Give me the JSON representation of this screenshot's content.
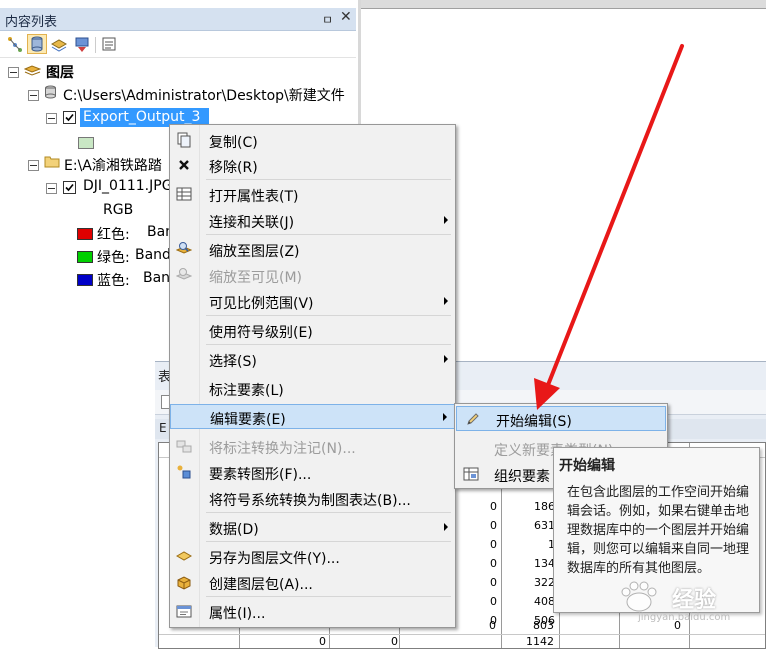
{
  "toc": {
    "title": "内容列表",
    "pin_glyph": "ㅁ",
    "close_glyph": "✕",
    "toolbar_icons": [
      "list-by-drawing-order-icon",
      "list-by-source-icon",
      "list-by-visibility-icon",
      "list-by-selection-icon",
      "options-icon"
    ],
    "tree": {
      "root_label": "图层",
      "source1": "C:\\Users\\Administrator\\Desktop\\新建文件",
      "layer1": "Export_Output_3",
      "source2": "E:\\A渝湘铁路踏",
      "layer2": "DJI_0111.JPG",
      "rgb_label": "RGB",
      "bands": [
        {
          "label": "红色:",
          "value": "Ban",
          "color": "#e00000"
        },
        {
          "label": "绿色:",
          "value": "Band",
          "color": "#00d000"
        },
        {
          "label": "蓝色:",
          "value": "Ban",
          "color": "#0000c8"
        }
      ]
    }
  },
  "table_window": {
    "title_fragment": "表",
    "tab_fragment": "E",
    "rows": [
      [
        "0",
        "186"
      ],
      [
        "0",
        "631"
      ],
      [
        "0",
        "1"
      ],
      [
        "0",
        "134"
      ],
      [
        "0",
        "322"
      ],
      [
        "0",
        "408"
      ],
      [
        "0",
        "506"
      ],
      [
        "0",
        "803",
        "0"
      ],
      [
        "0",
        "0",
        "1142"
      ]
    ]
  },
  "context_menu": {
    "items": [
      {
        "label": "复制(C)",
        "icon": "copy-icon",
        "enabled": true
      },
      {
        "label": "移除(R)",
        "icon": "remove-x-icon",
        "enabled": true
      },
      {
        "label": "打开属性表(T)",
        "icon": "attribute-table-icon",
        "enabled": true
      },
      {
        "label": "连接和关联(J)",
        "icon": "",
        "enabled": true,
        "submenu": true
      },
      {
        "label": "缩放至图层(Z)",
        "icon": "zoom-to-layer-icon",
        "enabled": true
      },
      {
        "label": "缩放至可见(M)",
        "icon": "zoom-to-visible-icon",
        "enabled": false
      },
      {
        "label": "可见比例范围(V)",
        "icon": "",
        "enabled": true,
        "submenu": true
      },
      {
        "label": "使用符号级别(E)",
        "icon": "",
        "enabled": true
      },
      {
        "label": "选择(S)",
        "icon": "",
        "enabled": true,
        "submenu": true
      },
      {
        "label": "标注要素(L)",
        "icon": "",
        "enabled": true
      },
      {
        "label": "编辑要素(E)",
        "icon": "",
        "enabled": true,
        "submenu": true,
        "highlighted": true
      },
      {
        "label": "将标注转换为注记(N)...",
        "icon": "convert-labels-icon",
        "enabled": false
      },
      {
        "label": "要素转图形(F)...",
        "icon": "features-to-graphics-icon",
        "enabled": true
      },
      {
        "label": "将符号系统转换为制图表达(B)...",
        "icon": "",
        "enabled": true
      },
      {
        "label": "数据(D)",
        "icon": "",
        "enabled": true,
        "submenu": true
      },
      {
        "label": "另存为图层文件(Y)...",
        "icon": "save-layer-file-icon",
        "enabled": true
      },
      {
        "label": "创建图层包(A)...",
        "icon": "create-layer-package-icon",
        "enabled": true
      },
      {
        "label": "属性(I)...",
        "icon": "properties-icon",
        "enabled": true
      }
    ]
  },
  "submenu": {
    "items": [
      {
        "label": "开始编辑(S)",
        "icon": "start-editing-pencil-icon",
        "enabled": true,
        "highlighted": true
      },
      {
        "label": "定义新要素类型(N)...",
        "icon": "",
        "enabled": false
      },
      {
        "label": "组织要素",
        "icon": "organize-features-icon",
        "enabled": true
      }
    ]
  },
  "tooltip": {
    "title": "开始编辑",
    "body": "在包含此图层的工作空间开始编辑会话。例如，如果右键单击地理数据库中的一个图层并开始编辑，则您可以编辑来自同一地理数据库的所有其他图层。"
  },
  "watermark": {
    "text": "经验",
    "url": "jingyan.baidu.com"
  },
  "colors": {
    "menu_highlight": "#cde3f8",
    "selected_layer": "#3399ff",
    "annotation_arrow": "#e81818"
  }
}
